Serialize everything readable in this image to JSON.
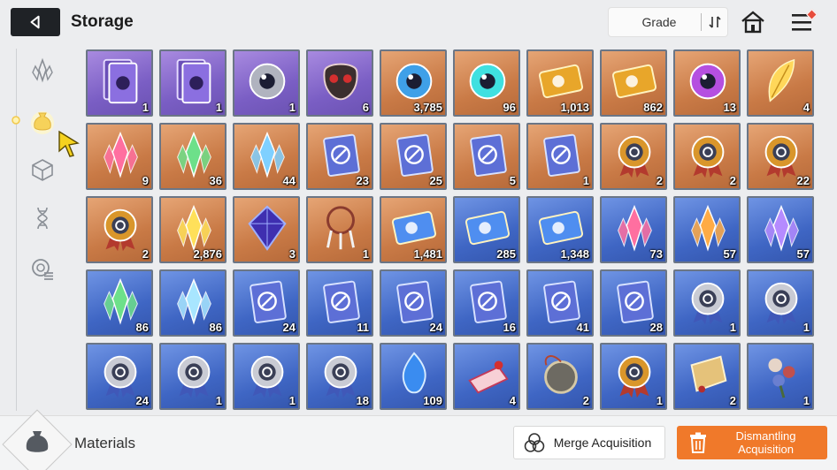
{
  "header": {
    "title": "Storage",
    "grade_label": "Grade"
  },
  "sidebar": {
    "items": [
      {
        "icon": "crystal-icon"
      },
      {
        "icon": "material-bag-icon",
        "active": true
      },
      {
        "icon": "cube-icon"
      },
      {
        "icon": "dna-icon"
      },
      {
        "icon": "gear-list-icon"
      }
    ]
  },
  "items": [
    {
      "rarity": "purple",
      "icon": "dual-eye-card-icon",
      "qty": "1"
    },
    {
      "rarity": "purple",
      "icon": "lily-card-icon",
      "qty": "1"
    },
    {
      "rarity": "purple",
      "icon": "silver-orb-icon",
      "qty": "1"
    },
    {
      "rarity": "purple",
      "icon": "red-mask-icon",
      "qty": "6"
    },
    {
      "rarity": "orange",
      "icon": "blue-orb-icon",
      "qty": "3,785"
    },
    {
      "rarity": "orange",
      "icon": "cyan-core-icon",
      "qty": "96"
    },
    {
      "rarity": "orange",
      "icon": "gold-id-ticket-icon",
      "qty": "1,013"
    },
    {
      "rarity": "orange",
      "icon": "gold-star-ticket-icon",
      "qty": "862"
    },
    {
      "rarity": "orange",
      "icon": "purple-eye-icon",
      "qty": "13"
    },
    {
      "rarity": "orange",
      "icon": "gold-feather-icon",
      "qty": "4"
    },
    {
      "rarity": "orange",
      "icon": "pink-crystal-icon",
      "qty": "9"
    },
    {
      "rarity": "orange",
      "icon": "green-crystal-icon",
      "qty": "36"
    },
    {
      "rarity": "orange",
      "icon": "blue-crystal-icon",
      "qty": "44"
    },
    {
      "rarity": "orange",
      "icon": "sword-book-icon",
      "qty": "23"
    },
    {
      "rarity": "orange",
      "icon": "eye-book-icon",
      "qty": "25"
    },
    {
      "rarity": "orange",
      "icon": "wing-book-icon",
      "qty": "5"
    },
    {
      "rarity": "orange",
      "icon": "slash-book-icon",
      "qty": "1"
    },
    {
      "rarity": "orange",
      "icon": "cross-medal-icon",
      "qty": "2"
    },
    {
      "rarity": "orange",
      "icon": "shield-medal-icon",
      "qty": "2"
    },
    {
      "rarity": "orange",
      "icon": "eye-medal-icon",
      "qty": "22"
    },
    {
      "rarity": "orange",
      "icon": "compass-medal-icon",
      "qty": "2"
    },
    {
      "rarity": "orange",
      "icon": "gold-shards-icon",
      "qty": "2,876"
    },
    {
      "rarity": "orange",
      "icon": "void-cube-icon",
      "qty": "3"
    },
    {
      "rarity": "orange",
      "icon": "dreamcatcher-icon",
      "qty": "1"
    },
    {
      "rarity": "orange",
      "icon": "music-ticket-icon",
      "qty": "1,481"
    },
    {
      "rarity": "blue",
      "icon": "blue-id-ticket-icon",
      "qty": "285"
    },
    {
      "rarity": "blue",
      "icon": "blue-star-ticket-icon",
      "qty": "1,348"
    },
    {
      "rarity": "blue",
      "icon": "red-shard-icon",
      "qty": "73"
    },
    {
      "rarity": "blue",
      "icon": "orange-shard-icon",
      "qty": "57"
    },
    {
      "rarity": "blue",
      "icon": "violet-shard-icon",
      "qty": "57"
    },
    {
      "rarity": "blue",
      "icon": "green-shard-icon",
      "qty": "86"
    },
    {
      "rarity": "blue",
      "icon": "ice-shard-icon",
      "qty": "86"
    },
    {
      "rarity": "blue",
      "icon": "sword-book-icon",
      "qty": "24"
    },
    {
      "rarity": "blue",
      "icon": "shield-book-icon",
      "qty": "11"
    },
    {
      "rarity": "blue",
      "icon": "eye-book-icon",
      "qty": "24"
    },
    {
      "rarity": "blue",
      "icon": "wing-book-icon",
      "qty": "16"
    },
    {
      "rarity": "blue",
      "icon": "slash-book-icon",
      "qty": "41"
    },
    {
      "rarity": "blue",
      "icon": "web-book-icon",
      "qty": "28"
    },
    {
      "rarity": "blue",
      "icon": "cross-silver-medal-icon",
      "qty": "1"
    },
    {
      "rarity": "blue",
      "icon": "shield-silver-medal-icon",
      "qty": "1"
    },
    {
      "rarity": "blue",
      "icon": "eye-silver-medal-icon",
      "qty": "24"
    },
    {
      "rarity": "blue",
      "icon": "x-silver-medal-icon",
      "qty": "1"
    },
    {
      "rarity": "blue",
      "icon": "slash-silver-medal-icon",
      "qty": "1"
    },
    {
      "rarity": "blue",
      "icon": "globe-silver-medal-icon",
      "qty": "18"
    },
    {
      "rarity": "blue",
      "icon": "blue-flame-icon",
      "qty": "109"
    },
    {
      "rarity": "blue",
      "icon": "cake-slice-icon",
      "qty": "4"
    },
    {
      "rarity": "blue",
      "icon": "pocket-watch-icon",
      "qty": "2"
    },
    {
      "rarity": "blue",
      "icon": "red-star-medal-icon",
      "qty": "1"
    },
    {
      "rarity": "blue",
      "icon": "gold-parchment-icon",
      "qty": "2"
    },
    {
      "rarity": "blue",
      "icon": "flower-bouquet-icon",
      "qty": "1"
    }
  ],
  "footer": {
    "category_label": "Materials",
    "merge_label": "Merge Acquisition",
    "dismantle_label": "Dismantling Acquisition"
  },
  "colors": {
    "purple": "#7a5ec4",
    "orange": "#c97a46",
    "blue": "#3f66c4",
    "dismantle": "#f0792a"
  }
}
